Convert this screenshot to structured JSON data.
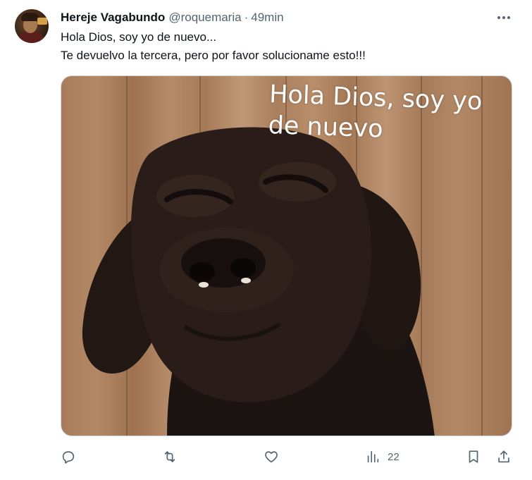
{
  "tweet": {
    "author": {
      "name": "Hereje Vagabundo",
      "handle": "@roquemaria",
      "separator": "·",
      "time": "49min"
    },
    "text_lines": [
      "Hola Dios, soy yo de nuevo...",
      "Te devuelvo la tercera, pero por favor solucioname esto!!!"
    ],
    "media": {
      "caption_lines": [
        "Hola Dios, soy yo",
        "de nuevo"
      ]
    },
    "actions": {
      "reply": {
        "icon": "reply-icon"
      },
      "retweet": {
        "icon": "retweet-icon"
      },
      "like": {
        "icon": "heart-icon"
      },
      "views": {
        "icon": "views-icon",
        "count": "22"
      },
      "bookmark": {
        "icon": "bookmark-icon"
      },
      "share": {
        "icon": "share-icon"
      }
    },
    "colors": {
      "text": "#0f1419",
      "secondary": "#536471",
      "border": "#cfd9de"
    }
  }
}
